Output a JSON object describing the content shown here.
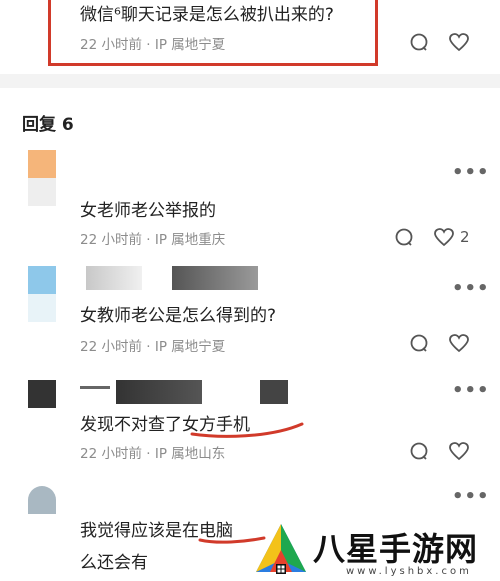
{
  "question": {
    "text": "微信⁶聊天记录是怎么被扒出来的?",
    "meta": "22 小时前 · IP 属地宁夏"
  },
  "replies_header": "回复 6",
  "comments": [
    {
      "text": "女老师老公举报的",
      "meta": "22 小时前 · IP 属地重庆",
      "likes": "2"
    },
    {
      "text": "女教师老公是怎么得到的?",
      "meta": "22 小时前 · IP 属地宁夏",
      "likes": ""
    },
    {
      "text": "发现不对查了女方手机",
      "meta": "22 小时前 · IP 属地山东",
      "likes": ""
    },
    {
      "text_line1": "我觉得应该是在电脑",
      "text_line2": "么还会有"
    }
  ],
  "colors": {
    "highlight": "#d13a2a",
    "meta_gray": "#8c8c8c",
    "avatar_orange": "#f5b57a",
    "avatar_blue": "#8ec8ea"
  },
  "watermark": {
    "brand": "八星手游网",
    "url": "www.lyshbx.com"
  },
  "icons": [
    "comment-icon",
    "heart-icon",
    "more-icon"
  ]
}
